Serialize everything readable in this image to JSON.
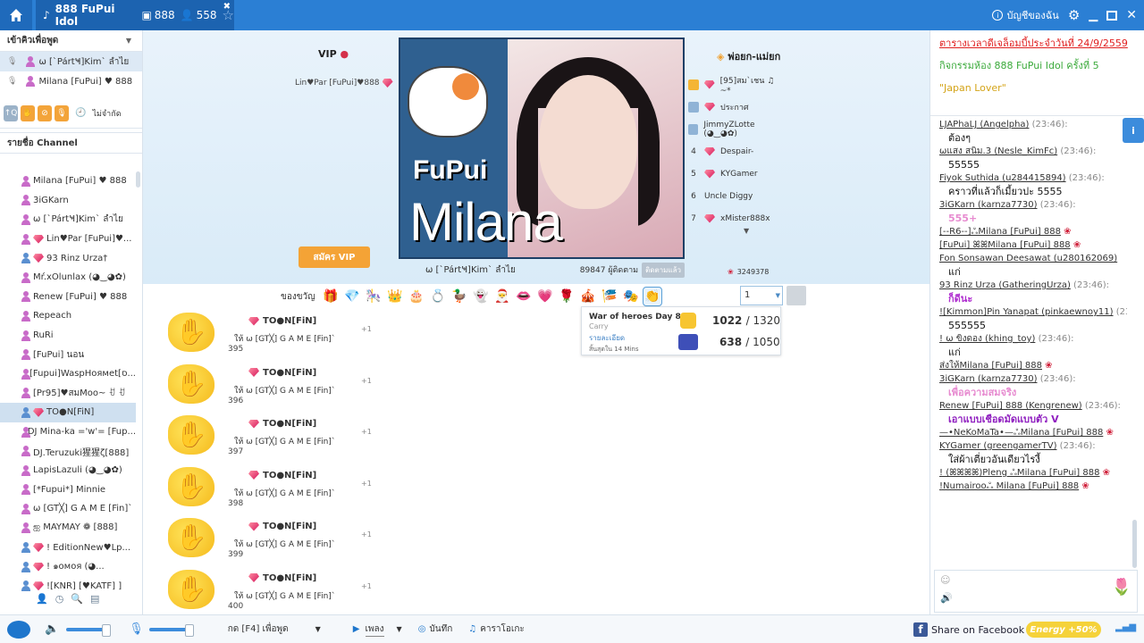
{
  "titlebar": {
    "room_name": "888 FuPui Idol",
    "count1": "888",
    "count2": "558",
    "account_label": "บัญชีของฉัน"
  },
  "left": {
    "queue_title": "เข้าคิวเพื่อพูด",
    "mic_users": [
      {
        "name": "ω [`PártҸ]Kim` ลำไย",
        "sel": true
      },
      {
        "name": "Milana [FuPui] ♥ 888",
        "sel": false
      }
    ],
    "tools_label": "ไม่จำกัด",
    "channel_title": "รายชื่อ Channel",
    "channel_users": [
      {
        "name": "Milana [FuPui] ♥ 888",
        "c": "#c86bc8",
        "gem": false
      },
      {
        "name": "3iGKarn",
        "c": "#c86bc8",
        "gem": false
      },
      {
        "name": "ω [`PártҸ]Kim` ลำไย",
        "c": "#c86bc8",
        "gem": false
      },
      {
        "name": "Lin♥Par [FuPui]♥...",
        "c": "#c86bc8",
        "gem": true
      },
      {
        "name": "93 Rinz Urza†",
        "c": "#5a8fd0",
        "gem": true
      },
      {
        "name": "Mŕ.xOlunlax (◕‿◕✿)",
        "c": "#c86bc8",
        "gem": false
      },
      {
        "name": "Renew [FuPui] ♥ 888",
        "c": "#c86bc8",
        "gem": false
      },
      {
        "name": "Repeach",
        "c": "#c86bc8",
        "gem": false
      },
      {
        "name": "RuRi",
        "c": "#c86bc8",
        "gem": false
      },
      {
        "name": "[FuPui] นอน",
        "c": "#c86bc8",
        "gem": false
      },
      {
        "name": "[Fupui]WaspHoямet[ס...",
        "c": "#c86bc8",
        "gem": false
      },
      {
        "name": "[Pr95]♥สมMoo~ ꀀ ꀀ",
        "c": "#c86bc8",
        "gem": false
      },
      {
        "name": "TO●N[FiN]",
        "c": "#5a8fd0",
        "gem": true
      },
      {
        "name": "DJ Mina-ka ='w'= [Fup...",
        "c": "#c86bc8",
        "gem": false
      },
      {
        "name": "DJ.Teruzuki猩猩ζ[888]",
        "c": "#c86bc8",
        "gem": false
      },
      {
        "name": "LapisLazuli (◕‿◕✿)",
        "c": "#c86bc8",
        "gem": false
      },
      {
        "name": "[*Fupui*] Minnie",
        "c": "#c86bc8",
        "gem": false
      },
      {
        "name": "ω [GT╳] G A M E [Fin]`",
        "c": "#c86bc8",
        "gem": false
      },
      {
        "name": "ஐ MAYMAY ❁ [888]",
        "c": "#c86bc8",
        "gem": false
      },
      {
        "name": "! EditionNew♥Lp...",
        "c": "#5a8fd0",
        "gem": true
      },
      {
        "name": "! ๑ᴏᴍᴏя (◕...",
        "c": "#5a8fd0",
        "gem": true
      },
      {
        "name": "![KNR] [♥KATF] ]",
        "c": "#5a8fd0",
        "gem": true
      }
    ]
  },
  "stage": {
    "vip_title": "VIP",
    "fan_title": "พ่อยก-แม่ยก",
    "vip_user": "Lin♥Par [FuPui]♥888",
    "vip_button": "สมัคร VIP",
    "brand_line1": "FuPui",
    "brand_line2": "Milana",
    "cam_name": "ω [`PártҸ]Kim` ลำไย",
    "follower_count": "89847 ผู้ติดตาม",
    "followed_label": "ติดตามแล้ว",
    "rose_count": "3249378",
    "fans": [
      {
        "rank": "",
        "name": "[95]สม`เชน ♫ ~*"
      },
      {
        "rank": "",
        "name": "ประกาศ"
      },
      {
        "rank": "",
        "name": "JimmyZLotte (◕‿◕✿)"
      },
      {
        "rank": "4",
        "name": "Despair-"
      },
      {
        "rank": "5",
        "name": "KYGamer"
      },
      {
        "rank": "6",
        "name": "Uncle Diggy"
      },
      {
        "rank": "7",
        "name": "xMister888x"
      }
    ]
  },
  "gifts": {
    "label": "ของขวัญ",
    "items": [
      "🎁",
      "💎",
      "🎠",
      "👑",
      "🎂",
      "💍",
      "🦆",
      "👻",
      "🎅",
      "👄",
      "💗",
      "🌹",
      "🎪",
      "🎏",
      "🎭",
      "👏"
    ],
    "qty": "1"
  },
  "feed": [
    {
      "num": "395",
      "who": "TO●N[FiN]",
      "to": "ให้ ω [GT╳] G A M E [Fin]`",
      "plus": "+1"
    },
    {
      "num": "396",
      "who": "TO●N[FiN]",
      "to": "ให้ ω [GT╳] G A M E [Fin]`",
      "plus": "+1"
    },
    {
      "num": "397",
      "who": "TO●N[FiN]",
      "to": "ให้ ω [GT╳] G A M E [Fin]`",
      "plus": "+1"
    },
    {
      "num": "398",
      "who": "TO●N[FiN]",
      "to": "ให้ ω [GT╳] G A M E [Fin]`",
      "plus": "+1"
    },
    {
      "num": "399",
      "who": "TO●N[FiN]",
      "to": "ให้ ω [GT╳] G A M E [Fin]`",
      "plus": "+1"
    },
    {
      "num": "400",
      "who": "TO●N[FiN]",
      "to": "ให้ ω [GT╳] G A M E [Fin]`",
      "plus": "+1"
    }
  ],
  "popup": {
    "title": "War of heroes Day 8",
    "sub": "Carry",
    "detail": "รายละเอียด",
    "ends": "สิ้นสุดใน 14 Mins",
    "score1": "1022",
    "total1": "/ 1320",
    "score2": "638",
    "total2": "/ 1050"
  },
  "chat": {
    "announce1": "ตารางเวลาดีเจล็อมบี้ประจำวันที่ 24/9/2559",
    "announce2": "กิจกรรมห้อง 888 FuPui Idol ครั้งที่ 5",
    "announce3": "\"Japan Lover\"",
    "messages": [
      {
        "u": "LJAPhaLJ (Angelpha)",
        "t": "(23:46):",
        "m": "ต้องๆ",
        "mc": "#111"
      },
      {
        "u": "ωแสง สนิม.3 (Nesle_KimFc)",
        "t": "(23:46):",
        "m": "55555",
        "mc": "#111"
      },
      {
        "u": "Fiyok Suthida (u284415894)",
        "t": "(23:46):",
        "m": "คราวที่แล้วก็เมี้ยวปะ 5555",
        "mc": "#111"
      },
      {
        "u": "3iGKarn (karnza7730)",
        "t": "(23:46):",
        "m": "555+",
        "mc": "#e78bd0"
      },
      {
        "u": "[--R6--]ஃMilana [FuPui] 888",
        "t": "",
        "m": "",
        "mc": "#111"
      },
      {
        "u": "[FuPui] ꕤꕤMilana [FuPui] 888",
        "t": "",
        "m": "",
        "mc": "#111"
      },
      {
        "u": "Fon Sonsawan Deesawat (u280162069)",
        "t": "",
        "m": "แก่",
        "mc": "#111"
      },
      {
        "u": "93 Rinz Urza (GatheringUrza)",
        "t": "(23:46):",
        "m": "ก็ดีนะ",
        "mc": "#b02fd0"
      },
      {
        "u": "![Kimmon]Pin Yanapat (pinkaewnoy11)",
        "t": "(23:46):",
        "m": "555555",
        "mc": "#111"
      },
      {
        "u": "! ω ขิงดอง (khing_toy)",
        "t": "(23:46):",
        "m": "แก่",
        "mc": "#111"
      },
      {
        "u": "ส่งให้Milana [FuPui] 888",
        "t": "",
        "m": "",
        "mc": "#111"
      },
      {
        "u": "3iGKarn (karnza7730)",
        "t": "(23:46):",
        "m": "เพื่อความสมจริง",
        "mc": "#e78bd0"
      },
      {
        "u": "Renew [FuPui] 888 (Kengrenew)",
        "t": "(23:46):",
        "m": "เอาแบบเชือดมัดแบบตัว V",
        "mc": "#9020c0"
      },
      {
        "u": "—•NeKoMaTa•—ஃMilana [FuPui] 888",
        "t": "",
        "m": "",
        "mc": "#111"
      },
      {
        "u": "KYGamer (greengamerTV)",
        "t": "(23:46):",
        "m": "ใส่ผ้าเตี่ยวอันเดียวไรงี้",
        "mc": "#111"
      },
      {
        "u": "! (ꕤꕤꕤꕤ)Pleng ஃMilana [FuPui] 888",
        "t": "",
        "m": "",
        "mc": "#111"
      },
      {
        "u": "!Numairooஃ Milana [FuPui] 888",
        "t": "",
        "m": "",
        "mc": "#111"
      }
    ]
  },
  "bottom": {
    "push_to_talk": "กด [F4] เพื่อพูด",
    "music": "เพลง",
    "record": "บันทึก",
    "karaoke": "คาราโอเกะ",
    "share": "Share on Facebook",
    "energy": "Energy +50%"
  },
  "colors": {
    "titlebar": "#2b7fd4",
    "accent": "#3c8cdc",
    "vip_button": "#f4a336"
  }
}
